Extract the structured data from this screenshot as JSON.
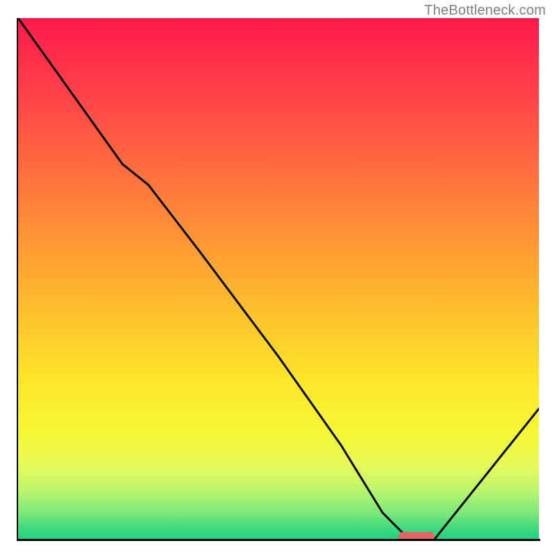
{
  "watermark": "TheBottleneck.com",
  "chart_data": {
    "type": "line",
    "title": "",
    "xlabel": "",
    "ylabel": "",
    "xlim": [
      0,
      100
    ],
    "ylim": [
      0,
      100
    ],
    "grid": false,
    "legend": false,
    "series": [
      {
        "name": "bottleneck-curve",
        "x": [
          0,
          10,
          20,
          25,
          35,
          50,
          62,
          70,
          75,
          80,
          100
        ],
        "y": [
          100,
          86,
          72,
          68,
          55,
          35,
          18,
          5,
          0,
          0,
          25
        ]
      }
    ],
    "marker": {
      "x_start": 73,
      "x_end": 80,
      "y": 0,
      "color": "#e06666"
    },
    "background_gradient": {
      "stops": [
        {
          "pos": 0,
          "color": "#ff1a4b"
        },
        {
          "pos": 12,
          "color": "#ff3a4a"
        },
        {
          "pos": 28,
          "color": "#ff6a3f"
        },
        {
          "pos": 44,
          "color": "#ff9a34"
        },
        {
          "pos": 58,
          "color": "#fcc52c"
        },
        {
          "pos": 70,
          "color": "#fde72a"
        },
        {
          "pos": 80,
          "color": "#f6f835"
        },
        {
          "pos": 86,
          "color": "#e6fb5a"
        },
        {
          "pos": 91,
          "color": "#b7f56e"
        },
        {
          "pos": 95,
          "color": "#7de87a"
        },
        {
          "pos": 98,
          "color": "#3fd97e"
        },
        {
          "pos": 100,
          "color": "#1fd183"
        }
      ]
    }
  }
}
